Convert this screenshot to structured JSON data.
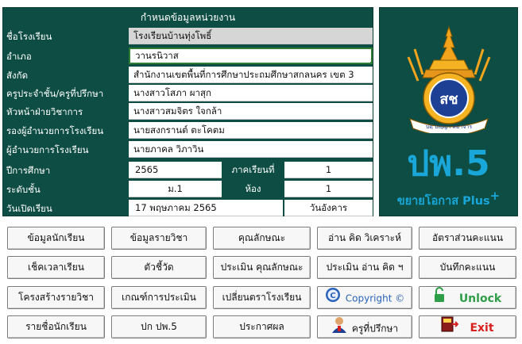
{
  "panel": {
    "title": "กำหนดข้อมูลหน่วยงาน",
    "school_label": "ชื่อโรงเรียน",
    "school_value": "โรงเรียนบ้านทุ่งโพธิ์",
    "district_label": "อำเภอ",
    "district_value": "วานรนิวาส",
    "affiliation_label": "สังกัด",
    "affiliation_value": "สำนักงานเขตพื้นที่การศึกษาประถมศึกษาสกลนคร เขต 3",
    "teacher_label": "ครูประจำชั้น/ครูที่ปรึกษา",
    "teacher_value": "นางสาวโสภา ผาสุก",
    "academic_head_label": "หัวหน้าฝ่ายวิชาการ",
    "academic_head_value": "นางสาวสมจิตร ใจกล้า",
    "deputy_label": "รองผู้อำนวยการโรงเรียน",
    "deputy_value": "นายสงกรานต์ ตะโคตม",
    "director_label": "ผู้อำนวยการโรงเรียน",
    "director_value": "นายภาคล วิภาวิน",
    "year_label": "ปีการศึกษา",
    "year_value": "2565",
    "semester_label": "ภาคเรียนที่",
    "semester_value": "1",
    "level_label": "ระดับชั้น",
    "level_value": "ม.1",
    "room_label": "ห้อง",
    "room_value": "1",
    "open_date_label": "วันเปิดเรียน",
    "open_date_value": "17 พฤษภาคม 2565",
    "open_day_value": "วันอังคาร"
  },
  "logo": {
    "emblem_text": "บดฺ ปญฺญา สมาจาร",
    "emblem_letters": "สช",
    "title": "ปพ.5",
    "subtitle": "ขยายโอกาส Plus",
    "subtitle_plus": "+"
  },
  "buttons": {
    "student_data": "ข้อมูลนักเรียน",
    "subject_data": "ข้อมูลรายวิชา",
    "characteristics": "คุณลักษณะ",
    "reading_thinking": "อ่าน คิด วิเคราะห์",
    "score_ratio": "อัตราส่วนคะแนน",
    "attendance": "เช็คเวลาเรียน",
    "indicators": "ตัวชี้วัด",
    "eval_characteristics": "ประเมิน คุณลักษณะ",
    "eval_reading": "ประเมิน อ่าน คิด ฯ",
    "record_scores": "บันทึกคะแนน",
    "course_structure": "โครงสร้างรายวิชา",
    "eval_criteria": "เกณฑ์การประเมิน",
    "change_emblem": "เปลี่ยนตราโรงเรียน",
    "copyright": "Copyright ©",
    "unlock": "Unlock",
    "student_list": "รายชื่อนักเรียน",
    "cover": "ปก ปพ.5",
    "announce": "ประกาศผล",
    "advisors": "ครูที่ปรึกษา",
    "exit": "Exit"
  },
  "colors": {
    "panel_bg": "#0d4d43",
    "brand_blue": "#19a7d9",
    "unlock_green": "#2e9e48",
    "exit_red": "#d92020"
  }
}
